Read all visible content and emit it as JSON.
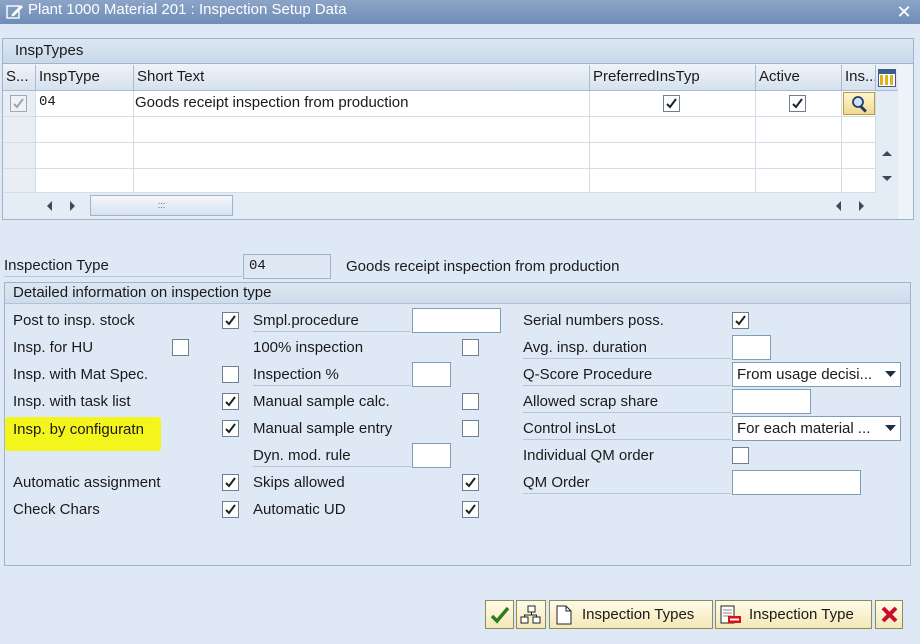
{
  "window": {
    "title": "Plant 1000 Material 201 : Inspection Setup Data",
    "close_glyph": "✕"
  },
  "table": {
    "title": "InspTypes",
    "columns": [
      "S...",
      "InspType",
      "Short Text",
      "PreferredInsTyp",
      "Active",
      "Ins..."
    ],
    "rows": [
      {
        "insp_type": "04",
        "short_text": "Goods receipt inspection from production",
        "preferred": true,
        "active": true
      }
    ],
    "scroll_glyph": ":::"
  },
  "header_fields": {
    "inspection_type_label": "Inspection Type",
    "inspection_type_value": "04",
    "inspection_type_desc": "Goods receipt inspection from production"
  },
  "detail": {
    "title": "Detailed information on inspection type",
    "col1": [
      {
        "label": "Post to insp. stock",
        "checked": true
      },
      {
        "label": "Insp. for HU",
        "checked": false
      },
      {
        "label": "Insp. with Mat Spec.",
        "checked": false
      },
      {
        "label": "Insp. with task list",
        "checked": true
      },
      {
        "label": "Insp. by configuratn",
        "checked": true,
        "highlight": "#f5f51e"
      },
      {
        "label": "Automatic assignment",
        "checked": true
      },
      {
        "label": "Check Chars",
        "checked": true
      }
    ],
    "col2": [
      {
        "label": "Smpl.procedure",
        "type": "input",
        "value": ""
      },
      {
        "label": "100% inspection",
        "type": "checkbox",
        "checked": false
      },
      {
        "label": "Inspection %",
        "type": "input",
        "value": ""
      },
      {
        "label": "Manual sample calc.",
        "type": "checkbox",
        "checked": false
      },
      {
        "label": "Manual sample entry",
        "type": "checkbox",
        "checked": false
      },
      {
        "label": "Dyn. mod. rule",
        "type": "input",
        "value": ""
      },
      {
        "label": "Skips allowed",
        "type": "checkbox",
        "checked": true
      },
      {
        "label": "Automatic UD",
        "type": "checkbox",
        "checked": true
      }
    ],
    "col3": [
      {
        "label": "Serial numbers poss.",
        "type": "checkbox",
        "checked": true
      },
      {
        "label": "Avg. insp. duration",
        "type": "input",
        "value": ""
      },
      {
        "label": "Q-Score Procedure",
        "type": "dropdown",
        "value": "From usage decisi..."
      },
      {
        "label": "Allowed scrap share",
        "type": "input",
        "value": ""
      },
      {
        "label": "Control insLot",
        "type": "dropdown",
        "value": "For each material ..."
      },
      {
        "label": "Individual QM order",
        "type": "checkbox",
        "checked": false
      },
      {
        "label": "QM Order",
        "type": "input",
        "value": ""
      }
    ]
  },
  "toolbar": {
    "inspection_types_label": "Inspection Types",
    "inspection_type_label": "Inspection Type"
  },
  "colors": {
    "highlight": "#f5f51e",
    "window_bg": "#dfe9f5",
    "title_bar": "#7f9cc2"
  }
}
